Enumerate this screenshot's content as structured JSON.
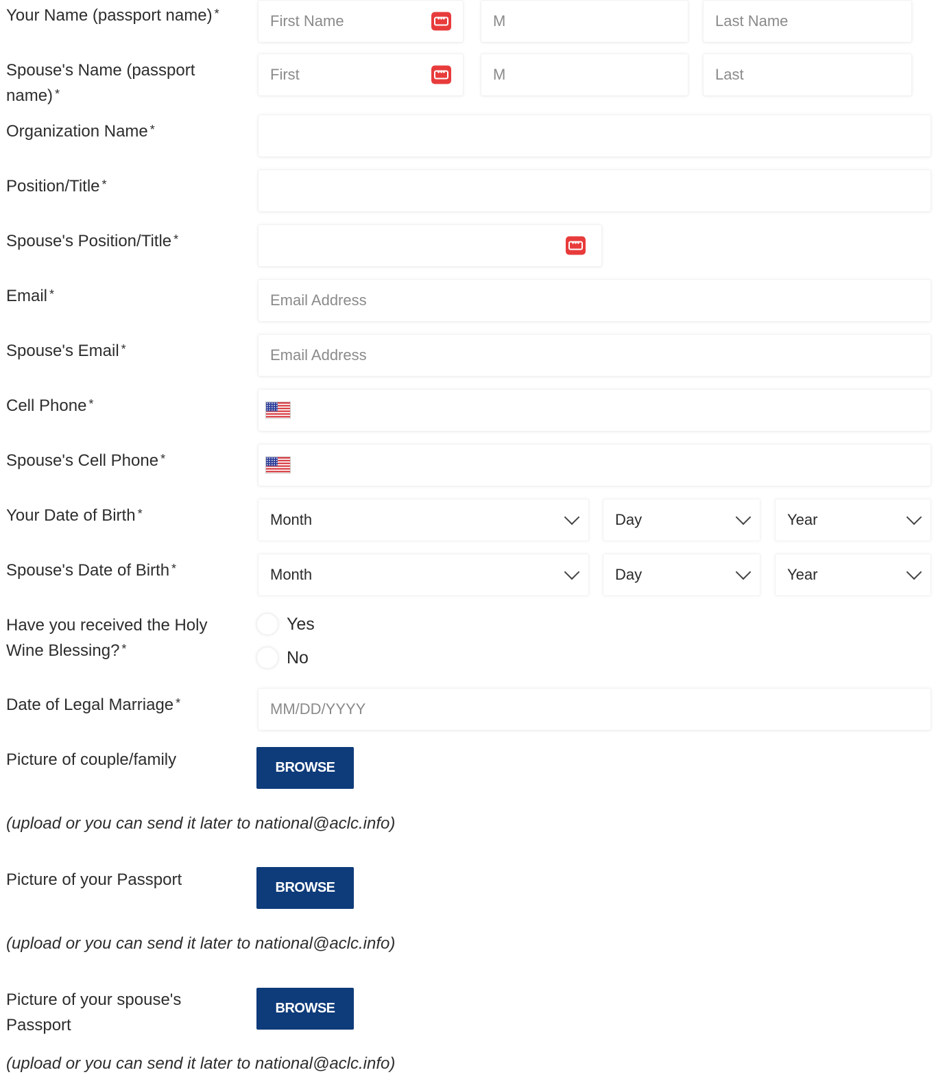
{
  "fields": {
    "your_name": {
      "label": "Your Name (passport name)",
      "first_placeholder": "First Name",
      "middle_placeholder": "M",
      "last_placeholder": "Last Name"
    },
    "spouse_name": {
      "label": "Spouse's Name (passport name)",
      "first_placeholder": "First",
      "middle_placeholder": "M",
      "last_placeholder": "Last"
    },
    "organization": {
      "label": "Organization Name"
    },
    "position": {
      "label": "Position/Title"
    },
    "spouse_position": {
      "label": "Spouse's Position/Title"
    },
    "email": {
      "label": "Email",
      "placeholder": "Email Address"
    },
    "spouse_email": {
      "label": "Spouse's Email",
      "placeholder": "Email Address"
    },
    "cell_phone": {
      "label": "Cell Phone"
    },
    "spouse_cell_phone": {
      "label": "Spouse's Cell Phone"
    },
    "your_dob": {
      "label": "Your Date of Birth",
      "month": "Month",
      "day": "Day",
      "year": "Year"
    },
    "spouse_dob": {
      "label": "Spouse's Date of Birth",
      "month": "Month",
      "day": "Day",
      "year": "Year"
    },
    "holy_wine": {
      "label": "Have you received the Holy Wine Blessing?",
      "options": [
        "Yes",
        "No"
      ]
    },
    "marriage_date": {
      "label": "Date of Legal Marriage",
      "placeholder": "MM/DD/YYYY"
    },
    "couple_picture": {
      "label": "Picture of couple/family",
      "button": "BROWSE",
      "note": "(upload or you can send it later to national@aclc.info)"
    },
    "passport_picture": {
      "label": "Picture of your Passport",
      "button": "BROWSE",
      "note": "(upload or you can send it later to national@aclc.info)"
    },
    "spouse_passport_picture": {
      "label": "Picture of your spouse's Passport",
      "button": "BROWSE",
      "note": "(upload or you can send it later to national@aclc.info)"
    }
  },
  "required_marker": "*",
  "icons": {
    "password_manager": "keypass-icon",
    "country_flag": "us-flag-icon",
    "dropdown": "chevron-down-icon"
  },
  "colors": {
    "button": "#0e3b7a",
    "icon_red": "#e83b3b"
  }
}
